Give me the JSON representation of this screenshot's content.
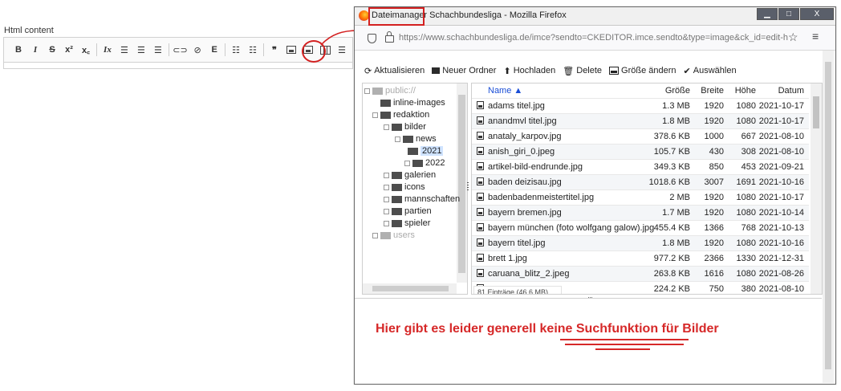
{
  "editor": {
    "label": "Html content",
    "toolbar": {
      "bold": "B",
      "italic": "I",
      "strike": "S",
      "sup": "x²",
      "sub": "x꜀",
      "remove_format": "Ix",
      "align_left": "☰",
      "align_center": "☰",
      "align_right": "☰",
      "link": "⊂⊃",
      "unlink": "⊘",
      "embed": "E",
      "bullets": "☷",
      "numbers": "☷",
      "quote": "❞",
      "more": "☰"
    }
  },
  "browser": {
    "title_highlighted": "Dateimanager",
    "title_rest": " Schachbundesliga - Mozilla Firefox",
    "min_label": "▁",
    "max_label": "□",
    "close_label": "X",
    "url": "https://www.schachbundesliga.de/imce?sendto=CKEDITOR.imce.sendto&type=image&ck_id=edit-html-cc",
    "star": "☆",
    "menu": "≡"
  },
  "imce": {
    "toolbar": {
      "refresh": "Aktualisieren",
      "refresh_icon": "⟳",
      "new_folder": "Neuer Ordner",
      "upload": "Hochladen",
      "upload_icon": "⬆",
      "delete": "Delete",
      "delete_icon": "🗑",
      "resize": "Größe ändern",
      "select": "Auswählen",
      "select_icon": "✔"
    },
    "tree": [
      {
        "label": "public://",
        "exp": "⊟",
        "dim": true
      },
      {
        "label": "inline-images",
        "exp": ""
      },
      {
        "label": "redaktion",
        "exp": "⊟"
      },
      {
        "label": "bilder",
        "exp": "⊟"
      },
      {
        "label": "news",
        "exp": "⊟"
      },
      {
        "label": "2021",
        "exp": "",
        "selected": true
      },
      {
        "label": "2022",
        "exp": "⊞"
      },
      {
        "label": "galerien",
        "exp": "⊞"
      },
      {
        "label": "icons",
        "exp": "⊞"
      },
      {
        "label": "mannschaften",
        "exp": "⊞"
      },
      {
        "label": "partien",
        "exp": "⊞"
      },
      {
        "label": "spieler",
        "exp": "⊞"
      },
      {
        "label": "users",
        "exp": "⊞",
        "dim": true
      }
    ],
    "columns": {
      "name": "Name ▲",
      "size": "Größe",
      "width": "Breite",
      "height": "Höhe",
      "date": "Datum"
    },
    "files": [
      {
        "name": "adams titel.jpg",
        "size": "1.3 MB",
        "w": "1920",
        "h": "1080",
        "d": "2021-10-17"
      },
      {
        "name": "anandmvl titel.jpg",
        "size": "1.8 MB",
        "w": "1920",
        "h": "1080",
        "d": "2021-10-17"
      },
      {
        "name": "anataly_karpov.jpg",
        "size": "378.6 KB",
        "w": "1000",
        "h": "667",
        "d": "2021-08-10"
      },
      {
        "name": "anish_giri_0.jpeg",
        "size": "105.7 KB",
        "w": "430",
        "h": "308",
        "d": "2021-08-10"
      },
      {
        "name": "artikel-bild-endrunde.jpg",
        "size": "349.3 KB",
        "w": "850",
        "h": "453",
        "d": "2021-09-21"
      },
      {
        "name": "baden deizisau.jpg",
        "size": "1018.6 KB",
        "w": "3007",
        "h": "1691",
        "d": "2021-10-16"
      },
      {
        "name": "badenbadenmeistertitel.jpg",
        "size": "2 MB",
        "w": "1920",
        "h": "1080",
        "d": "2021-10-17"
      },
      {
        "name": "bayern bremen.jpg",
        "size": "1.7 MB",
        "w": "1920",
        "h": "1080",
        "d": "2021-10-14"
      },
      {
        "name": "bayern münchen (foto wolfgang galow).jpg",
        "size": "455.4 KB",
        "w": "1366",
        "h": "768",
        "d": "2021-10-13"
      },
      {
        "name": "bayern titel.jpg",
        "size": "1.8 MB",
        "w": "1920",
        "h": "1080",
        "d": "2021-10-16"
      },
      {
        "name": "brett 1.jpg",
        "size": "977.2 KB",
        "w": "2366",
        "h": "1330",
        "d": "2021-12-31"
      },
      {
        "name": "caruana_blitz_2.jpeg",
        "size": "263.8 KB",
        "w": "1616",
        "h": "1080",
        "d": "2021-08-26"
      },
      {
        "name": "",
        "size": "224.2 KB",
        "w": "750",
        "h": "380",
        "d": "2021-08-10"
      }
    ],
    "status": "81 Einträge (46.6 MB)"
  },
  "annotation": {
    "note": "Hier gibt es leider generell keine Suchfunktion für Bilder"
  }
}
